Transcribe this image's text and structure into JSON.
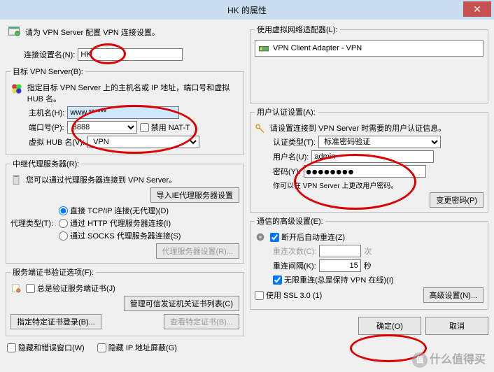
{
  "window_title": "HK 的属性",
  "left": {
    "intro_text": "请为 VPN Server 配置 VPN 连接设置。",
    "conn_label": "连接设置名(N):",
    "conn_value": "HK",
    "target_legend": "目标 VPN Server(B):",
    "target_text": "指定目标 VPN Server 上的主机名或 IP 地址，端口号和虚拟 HUB 名。",
    "host_label": "主机名(H):",
    "host_value": "www.******",
    "port_label": "端口号(P):",
    "port_value": "8888",
    "nat_label": "禁用 NAT-T",
    "hub_label": "虚拟 HUB 名(V):",
    "hub_value": "VPN",
    "relay_legend": "中继代理服务器(R):",
    "relay_text": "您可以通过代理服务器连接到 VPN Server。",
    "import_btn": "导入IE代理服务器设置",
    "proxy_type_label": "代理类型(T):",
    "proxy_radio_1": "直接 TCP/IP 连接(无代理)(D)",
    "proxy_radio_2": "通过 HTTP 代理服务器连接(I)",
    "proxy_radio_3": "通过 SOCKS 代理服务器连接(S)",
    "proxy_settings_btn": "代理服务器设置(R)...",
    "cert_legend": "服务端证书验证选项(F):",
    "cert_always": "总是验证服务端证书(J)",
    "manage_ca_btn": "管理可信发证机关证书列表(C)",
    "specify_cert_btn": "指定特定证书登录(B)...",
    "view_cert_btn": "查看特定证书(B)...",
    "hide_window": "隐藏和错误窗口(W)",
    "hide_ip": "隐藏 IP 地址屏蔽(G)"
  },
  "right": {
    "adapter_legend": "使用虚拟网络适配器(L):",
    "adapter_text": "VPN Client Adapter - VPN",
    "auth_legend": "用户认证设置(A):",
    "auth_text": "请设置连接到 VPN Server 时需要的用户认证信息。",
    "auth_type_label": "认证类型(T):",
    "auth_type_value": "标准密码验证",
    "user_label": "用户名(U):",
    "user_value": "admin",
    "pwd_label": "密码(Y):",
    "pwd_value": "●●●●●●●●",
    "pwd_note": "你可以在 VPN Server 上更改用户密码。",
    "change_pwd_btn": "变更密码(P)",
    "adv_legend": "通信的高级设置(E):",
    "reconnect_chk": "断开后自动重连(Z)",
    "retry_label": "重连次数(C):",
    "retry_unit": "次",
    "interval_label": "重连间隔(K):",
    "interval_value": "15",
    "interval_unit": "秒",
    "infinite_chk": "无限重连(总是保持 VPN 在线)(I)",
    "ssl_chk": "使用 SSL 3.0 (1)",
    "adv_btn": "高级设置(N)...",
    "ok_btn": "确定(O)",
    "cancel_btn": "取消"
  },
  "watermark": "什么值得买"
}
